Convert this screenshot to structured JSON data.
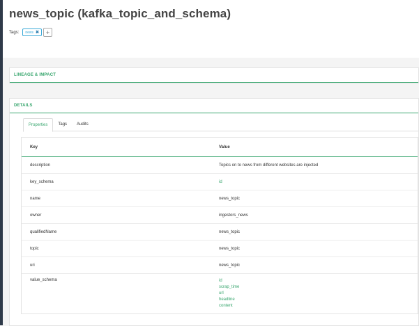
{
  "header": {
    "title": "news_topic (kafka_topic_and_schema)",
    "tags_label": "Tags:",
    "tags": [
      "news"
    ],
    "add_tag_symbol": "+"
  },
  "lineage": {
    "title": "LINEAGE & IMPACT"
  },
  "details": {
    "title": "DETAILS",
    "tabs": [
      "Properties",
      "Tags",
      "Audits"
    ],
    "active_tab": "Properties",
    "table": {
      "headers": [
        "Key",
        "Value"
      ],
      "rows": [
        {
          "key": "description",
          "value": "Topics on to news from different websites are injected"
        },
        {
          "key": "key_schema",
          "value": "id"
        },
        {
          "key": "name",
          "value": "news_topic"
        },
        {
          "key": "owner",
          "value": "ingestors_news"
        },
        {
          "key": "qualifiedName",
          "value": "news_topic"
        },
        {
          "key": "topic",
          "value": "news_topic"
        },
        {
          "key": "uri",
          "value": "news_topic"
        },
        {
          "key": "value_schema",
          "values": [
            "id",
            "scrap_time",
            "url",
            "headline",
            "content"
          ]
        }
      ]
    }
  },
  "colors": {
    "accent": "#38a66e",
    "tag": "#3aa9d8",
    "sidebar": "#2f3a49"
  }
}
